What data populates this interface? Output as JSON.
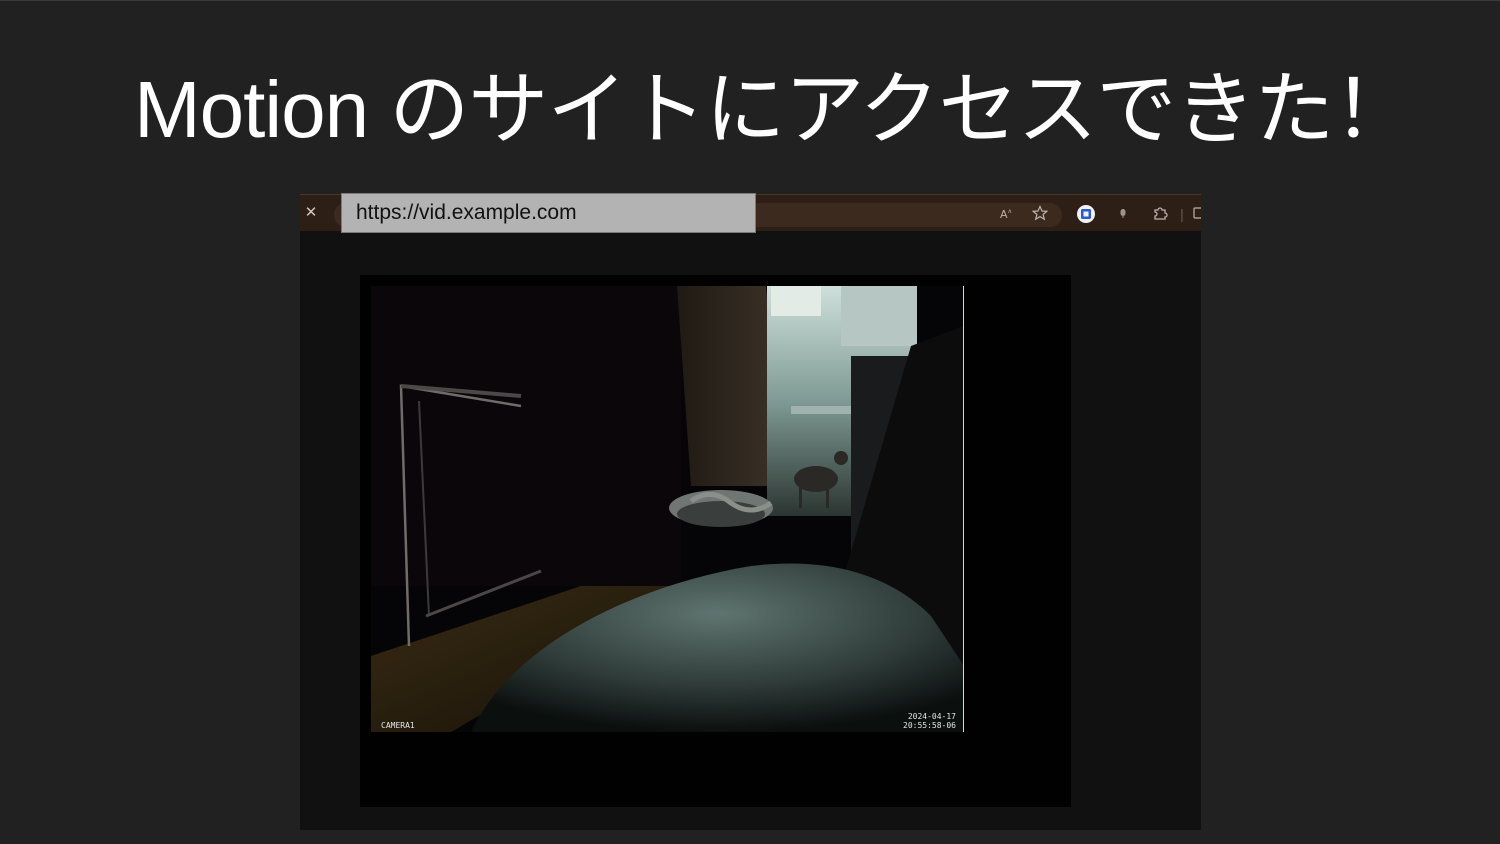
{
  "slide": {
    "title": "Motion のサイトにアクセスできた！"
  },
  "browser": {
    "url": "https://vid.example.com",
    "icons": [
      "close-icon",
      "read-aloud-icon",
      "favorite-star-icon",
      "extension-badge-icon",
      "mic-icon",
      "extensions-puzzle-icon",
      "split-screen-icon"
    ]
  },
  "camera": {
    "name": "CAMERA1",
    "date": "2024-04-17",
    "time": "20:55:58-06"
  },
  "colors": {
    "background": "#212121",
    "toolbar": "#2e1f16",
    "title_text": "#ffffff"
  }
}
